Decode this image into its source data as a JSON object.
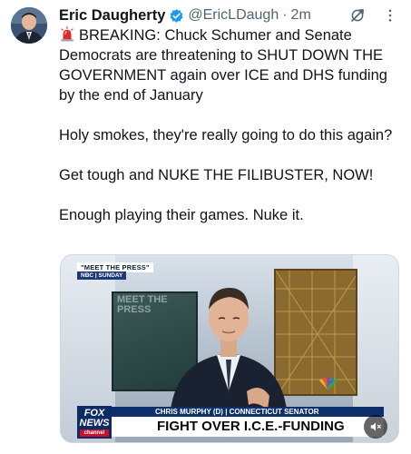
{
  "tweet": {
    "author_name": "Eric Daugherty",
    "handle": "@EricLDaugh",
    "separator": "·",
    "time": "2m",
    "lines": [
      "BREAKING: Chuck Schumer and Senate Democrats are threatening to SHUT DOWN THE GOVERNMENT again over ICE and DHS funding by the end of January",
      "Holy smokes, they're really going to do this again?",
      "Get tough and NUKE THE FILIBUSTER, NOW!",
      "Enough playing their games. Nuke it."
    ]
  },
  "icons": {
    "verified": "verified-badge-icon",
    "grok": "grok-icon",
    "more": "more-icon",
    "siren": "siren-emoji-icon",
    "mute": "volume-muted-icon"
  },
  "media": {
    "show_bug": "\"MEET THE PRESS\"",
    "show_bug_sub": "NBC | SUNDAY",
    "background_text": "MEET THE PRESS",
    "name_bar": "CHRIS MURPHY (D) | CONNECTICUT SENATOR",
    "headline": "FIGHT OVER I.C.E.-FUNDING",
    "fox_logo_line1": "FOX",
    "fox_logo_line2": "NEWS",
    "fox_logo_line3": "channel"
  },
  "colors": {
    "text": "#0f1419",
    "secondary": "#536471",
    "verified": "#1d9bf0",
    "fox_blue": "#0c2b66"
  }
}
